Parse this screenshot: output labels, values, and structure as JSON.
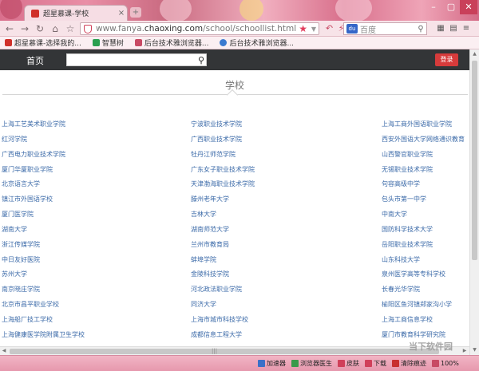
{
  "browser": {
    "tab_title": "超星慕课-学校",
    "tab_close": "×",
    "new_tab": "+",
    "window_buttons": [
      "–",
      "▢",
      "✕"
    ],
    "nav_buttons": [
      "←",
      "→",
      "↻",
      "⌂",
      "☆"
    ],
    "address": {
      "url_prefix": "www.fanya.",
      "url_domain": "chaoxing.com",
      "url_path": "/school/schoollist.html"
    },
    "search": {
      "engine": "百度",
      "placeholder": "百度"
    }
  },
  "bookmarks": [
    {
      "label": "超星慕课-选择我的...",
      "color": "#d0302a"
    },
    {
      "label": "智慧树",
      "color": "#2aa050"
    },
    {
      "label": "后台技术雅浏览器...",
      "color": "#c84a64"
    },
    {
      "label": "后台技术雅浏览器...",
      "color": "#3a7ad0"
    }
  ],
  "site": {
    "home": "首页",
    "search_icon": "⚲",
    "login": "登录",
    "section_title": "学校"
  },
  "schools": [
    [
      "上海工艺美术职业学院",
      "宁波职业技术学院",
      "上海工商外国语职业学院"
    ],
    [
      "红河学院",
      "广西职业技术学院",
      "西安外国语大学网络通识教育"
    ],
    [
      "广西电力职业技术学院",
      "牡丹江师范学院",
      "山西警官职业学院"
    ],
    [
      "厦门华厦职业学院",
      "广东女子职业技术学院",
      "无锡职业技术学院"
    ],
    [
      "北京语言大学",
      "天津渤海职业技术学院",
      "句容高级中学"
    ],
    [
      "镇江市外国语学校",
      "滕州老年大学",
      "包头市第一中学"
    ],
    [
      "厦门医学院",
      "吉林大学",
      "中南大学"
    ],
    [
      "湖南大学",
      "湖南师范大学",
      "国防科学技术大学"
    ],
    [
      "浙江传媒学院",
      "兰州市教育局",
      "岳阳职业技术学院"
    ],
    [
      "中日友好医院",
      "蚌埠学院",
      "山东科技大学"
    ],
    [
      "苏州大学",
      "金陵科技学院",
      "泉州医学高等专科学校"
    ],
    [
      "南京晓庄学院",
      "河北政法职业学院",
      "长春光华学院"
    ],
    [
      "北京市昌平职业学校",
      "同济大学",
      "榆阳区鱼河镇郑家沟小学"
    ],
    [
      "上海船厂技工学校",
      "上海市城市科技学校",
      "上海工商信息学校"
    ],
    [
      "上海健康医学院附属卫生学校",
      "成都信息工程大学",
      "厦门市教育科学研究院"
    ]
  ],
  "status": [
    {
      "label": "加速器",
      "color": "#3a70c8"
    },
    {
      "label": "浏览器医生",
      "color": "#3a9a4a"
    },
    {
      "label": "皮肤",
      "color": "#d0405a"
    },
    {
      "label": "下载",
      "color": "#d0405a"
    },
    {
      "label": "清除痕迹",
      "color": "#c83030"
    },
    {
      "label": "100%",
      "color": "#c84a64"
    }
  ],
  "watermark": "当下软件园"
}
